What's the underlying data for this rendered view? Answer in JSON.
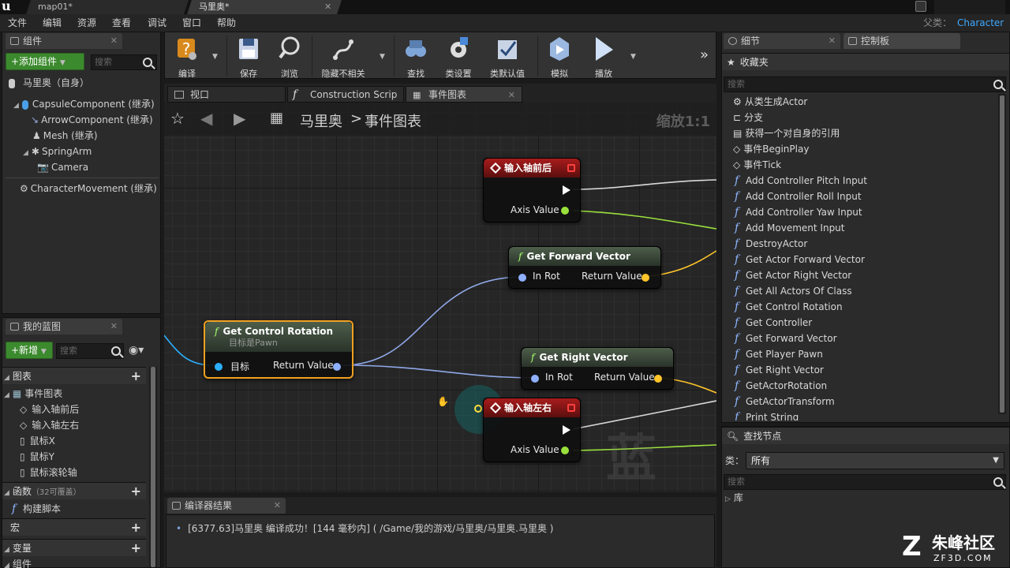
{
  "titlebar": {
    "tabs": [
      "map01*",
      "马里奥*"
    ],
    "parent_label": "父类：",
    "parent_value": "Character"
  },
  "menu": [
    "文件",
    "编辑",
    "资源",
    "查看",
    "调试",
    "窗口",
    "帮助"
  ],
  "components_panel": {
    "tab": "组件",
    "add_button": "+添加组件",
    "search_placeholder": "搜索",
    "root": "马里奥（自身）",
    "items": [
      "CapsuleComponent (继承)",
      "ArrowComponent (继承)",
      "Mesh (继承)",
      "SpringArm",
      "Camera",
      "CharacterMovement (继承)"
    ]
  },
  "my_blueprint": {
    "tab": "我的蓝图",
    "new_button": "+新增",
    "search_placeholder": "搜索",
    "graphs_header": "图表",
    "event_graph": "事件图表",
    "events": [
      "输入轴前后",
      "输入轴左右",
      "鼠标X",
      "鼠标Y",
      "鼠标滚轮轴"
    ],
    "functions_header": "函数",
    "functions_override": "（32可覆盖）",
    "construction_script": "构建脚本",
    "macros_header": "宏",
    "variables_header": "变量",
    "components_header": "组件"
  },
  "toolbar": {
    "compile": "编译",
    "save": "保存",
    "browse": "浏览",
    "hide_unrelated": "隐藏不相关",
    "find": "查找",
    "class_settings": "类设置",
    "class_defaults": "类默认值",
    "simulate": "模拟",
    "play": "播放"
  },
  "graph_tabs": [
    "视口",
    "Construction Scrip",
    "事件图表"
  ],
  "graph": {
    "breadcrumb_root": "马里奥",
    "breadcrumb_sep": ">",
    "breadcrumb_leaf": "事件图表",
    "zoom": "缩放1:1",
    "watermark": "蓝图"
  },
  "nodes": {
    "axis_forward": {
      "title": "输入轴前后",
      "out": "Axis Value"
    },
    "get_forward": {
      "title": "Get Forward Vector",
      "in": "In Rot",
      "out": "Return Value"
    },
    "get_control_rotation": {
      "title": "Get Control Rotation",
      "subtitle": "目标是Pawn",
      "in": "目标",
      "out": "Return Value"
    },
    "get_right": {
      "title": "Get Right Vector",
      "in": "In Rot",
      "out": "Return Value"
    },
    "axis_right": {
      "title": "输入轴左右",
      "out": "Axis Value"
    }
  },
  "compiler": {
    "tab": "编译器结果",
    "log": "[6377.63]马里奥 编译成功！[144 毫秒内] ( /Game/我的游戏/马里奥/马里奥.马里奥 )"
  },
  "details_tab": "细节",
  "palette": {
    "tab": "控制板",
    "favorites": "收藏夹",
    "search_placeholder": "搜索",
    "items": [
      {
        "icon": "spawn-icon",
        "label": "从类生成Actor"
      },
      {
        "icon": "branch-icon",
        "label": "分支"
      },
      {
        "icon": "self-icon",
        "label": "获得一个对自身的引用"
      },
      {
        "icon": "event-icon",
        "label": "事件BeginPlay"
      },
      {
        "icon": "event-icon",
        "label": "事件Tick"
      },
      {
        "icon": "function-icon",
        "label": "Add Controller Pitch Input"
      },
      {
        "icon": "function-icon",
        "label": "Add Controller Roll Input"
      },
      {
        "icon": "function-icon",
        "label": "Add Controller Yaw Input"
      },
      {
        "icon": "function-icon",
        "label": "Add Movement Input"
      },
      {
        "icon": "function-icon",
        "label": "DestroyActor"
      },
      {
        "icon": "function-icon",
        "label": "Get Actor Forward Vector"
      },
      {
        "icon": "function-icon",
        "label": "Get Actor Right Vector"
      },
      {
        "icon": "function-icon",
        "label": "Get All Actors Of Class"
      },
      {
        "icon": "function-icon",
        "label": "Get Control Rotation"
      },
      {
        "icon": "function-icon",
        "label": "Get Controller"
      },
      {
        "icon": "function-icon",
        "label": "Get Forward Vector"
      },
      {
        "icon": "function-icon",
        "label": "Get Player Pawn"
      },
      {
        "icon": "function-icon",
        "label": "Get Right Vector"
      },
      {
        "icon": "function-icon",
        "label": "GetActorRotation"
      },
      {
        "icon": "function-icon",
        "label": "GetActorTransform"
      },
      {
        "icon": "function-icon",
        "label": "Print String"
      }
    ],
    "find_node_header": "查找节点",
    "class_label": "类：",
    "class_value": "所有",
    "search2_placeholder": "搜索",
    "library": "库"
  },
  "branding": {
    "cn": "朱峰社区",
    "url": "ZF3D.COM"
  }
}
